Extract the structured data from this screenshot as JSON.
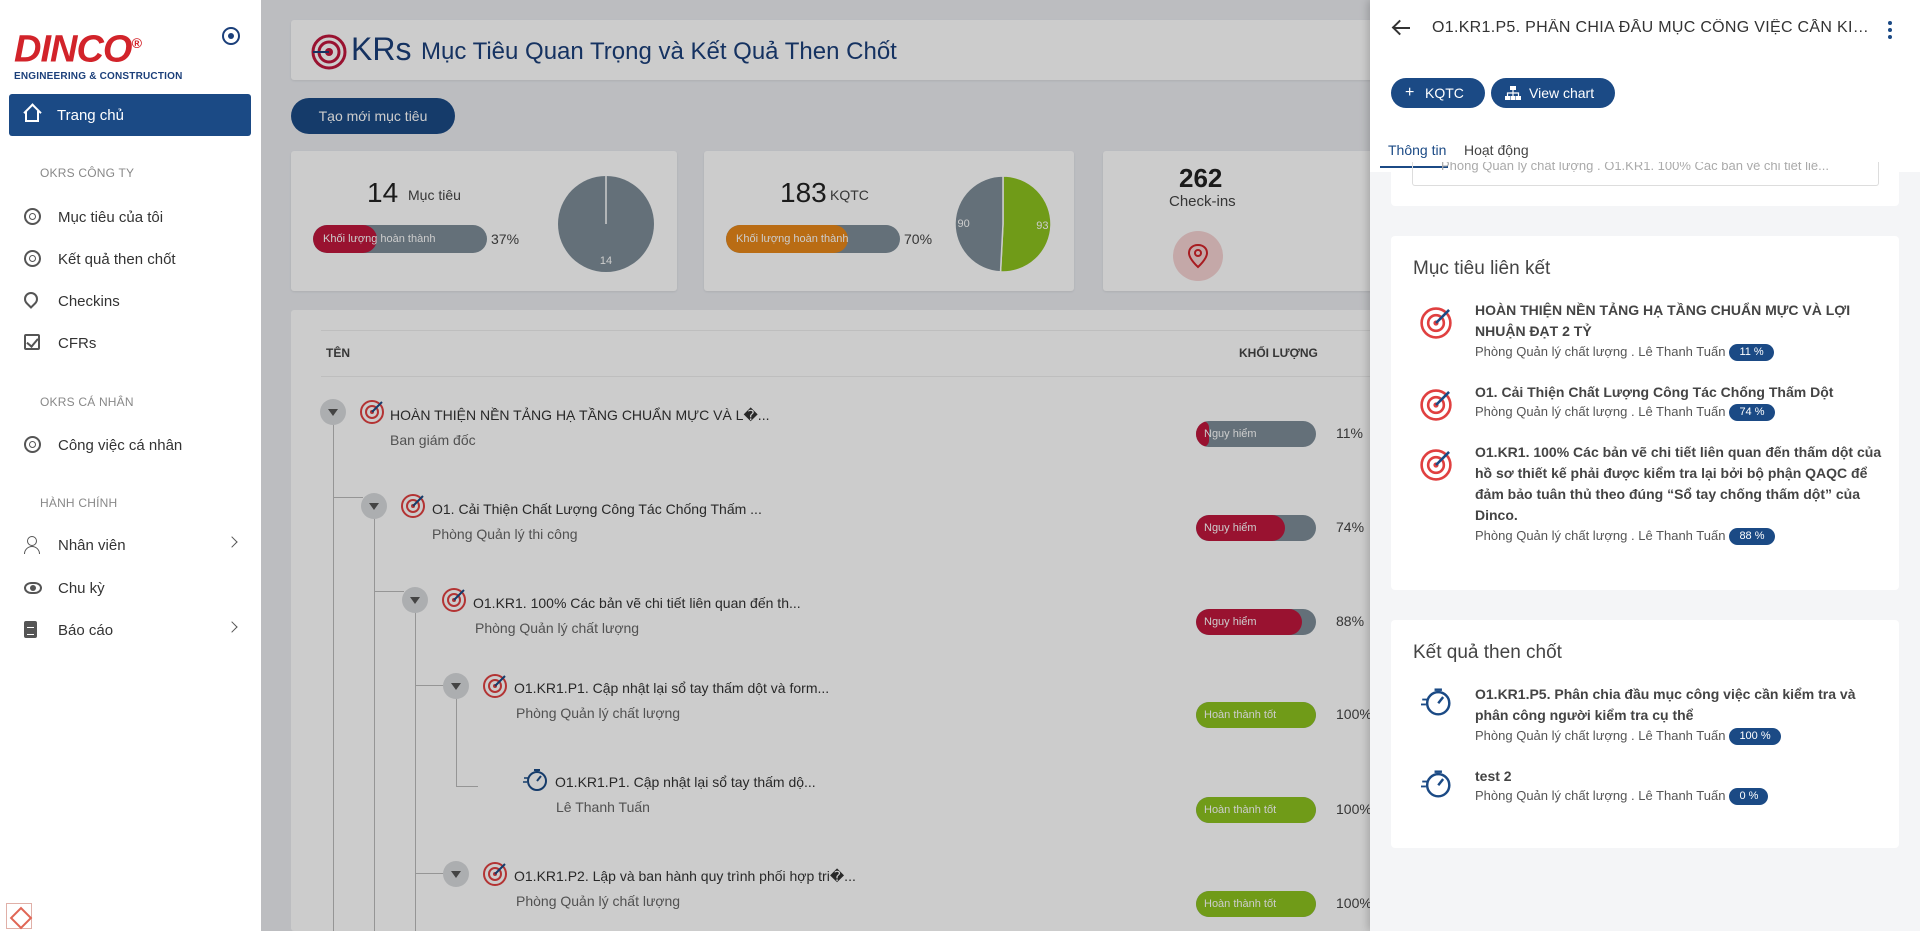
{
  "brand": {
    "logo_name": "DINCO",
    "logo_registered": "®",
    "logo_sub": "ENGINEERING & CONSTRUCTION"
  },
  "sidebar": {
    "home": "Trang chủ",
    "sections": [
      {
        "label": "OKRS CÔNG TY",
        "items": [
          "Mục tiêu của tôi",
          "Kết quả then chốt",
          "Checkins",
          "CFRs"
        ]
      },
      {
        "label": "OKRS CÁ NHÂN",
        "items": [
          "Công việc cá nhân"
        ]
      },
      {
        "label": "HÀNH CHÍNH",
        "items": [
          "Nhân viên",
          "Chu kỳ",
          "Báo cáo"
        ]
      }
    ]
  },
  "header": {
    "logo_text": "KRs",
    "title": "Mục Tiêu Quan Trọng và Kết Quả Then Chốt",
    "new_button": "Tạo mới mục tiêu"
  },
  "stats": [
    {
      "number": "14",
      "label": "Mục tiêu",
      "bar_label": "Khối lượng hoàn thành",
      "percent": "37%",
      "progress": 0.37,
      "bar_color": "#c0173c",
      "pie": {
        "slices": [
          {
            "value": 14,
            "label": "14",
            "color": "#7d8d98"
          }
        ]
      }
    },
    {
      "number": "183",
      "label": "KQTC",
      "bar_label": "Khối lượng hoàn thành",
      "percent": "70%",
      "progress": 0.7,
      "bar_color": "#e8881a",
      "pie": {
        "slices": [
          {
            "value": 93,
            "label": "93",
            "color": "#8dc21f"
          },
          {
            "value": 90,
            "label": "90",
            "color": "#7d8d98"
          }
        ]
      }
    },
    {
      "number": "262",
      "label": "Check-ins"
    }
  ],
  "table": {
    "col_name": "TÊN",
    "col_volume": "KHỐI LƯỢNG",
    "rows": [
      {
        "title": "HOÀN THIỆN NỀN TẢNG HẠ TẦNG CHUẨN MỰC VÀ L�...",
        "sub": "Ban giám đốc",
        "status": "Nguy hiểm",
        "pct": "11%",
        "progress": 0.11,
        "color": "#c0173c"
      },
      {
        "title": "O1. Cải Thiện Chất Lượng Công Tác Chống Thấm ...",
        "sub": "Phòng Quản lý thi công",
        "status": "Nguy hiểm",
        "pct": "74%",
        "progress": 0.74,
        "color": "#c0173c"
      },
      {
        "title": "O1.KR1. 100% Các bản vẽ chi tiết liên quan đến th...",
        "sub": "Phòng Quản lý chất lượng",
        "status": "Nguy hiểm",
        "pct": "88%",
        "progress": 0.88,
        "color": "#c0173c"
      },
      {
        "title": "O1.KR1.P1. Cập nhật lại sổ tay thấm dột và form...",
        "sub": "Phòng Quản lý chất lượng",
        "status": "Hoàn thành tốt",
        "pct": "100%",
        "progress": 1.0,
        "color": "#8dc21f"
      },
      {
        "title": "O1.KR1.P1. Cập nhật lại sổ tay thấm dộ...",
        "sub": "Lê Thanh Tuấn",
        "status": "Hoàn thành tốt",
        "pct": "100%",
        "progress": 1.0,
        "color": "#8dc21f"
      },
      {
        "title": "O1.KR1.P2. Lập và ban hành quy trình phối hợp tri�...",
        "sub": "Phòng Quản lý chất lượng",
        "status": "Hoàn thành tốt",
        "pct": "100%",
        "progress": 1.0,
        "color": "#8dc21f"
      }
    ]
  },
  "drawer": {
    "title": "O1.KR1.P5. PHÂN CHIA ĐẦU MỤC CÔNG VIỆC CẦN KIỂM ...",
    "btn_kqtc": "KQTC",
    "btn_chart": "View chart",
    "tab_info": "Thông tin",
    "tab_activity": "Hoạt động",
    "peek_text": "Phòng Quản lý chất lượng . O1.KR1. 100% Các bản vẽ chi tiết liê...",
    "linked_heading": "Mục tiêu liên kết",
    "linked": [
      {
        "title": "HOÀN THIỆN NỀN TẢNG HẠ TẦNG CHUẨN MỰC VÀ LỢI NHUẬN ĐẠT 2 TỶ",
        "meta": "Phòng Quản lý chất lượng . Lê Thanh Tuấn",
        "badge": "11 %"
      },
      {
        "title": "O1. Cải Thiện Chất Lượng Công Tác Chống Thấm Dột",
        "meta": "Phòng Quản lý chất lượng . Lê Thanh Tuấn",
        "badge": "74 %"
      },
      {
        "title": "O1.KR1. 100% Các bản vẽ chi tiết liên quan đến thấm dột của hồ sơ thiết kế phải được kiểm tra lại bởi bộ phận QAQC để đảm bảo tuân thủ theo đúng “Sổ tay chống thấm dột” của Dinco.",
        "meta": "Phòng Quản lý chất lượng . Lê Thanh Tuấn",
        "badge": "88 %"
      }
    ],
    "kr_heading": "Kết quả then chốt",
    "krs": [
      {
        "title": "O1.KR1.P5. Phân chia đầu mục công việc cần kiểm tra và phân công người kiểm tra cụ thể",
        "meta": "Phòng Quản lý chất lượng . Lê Thanh Tuấn",
        "badge": "100 %"
      },
      {
        "title": "test 2",
        "meta": "Phòng Quản lý chất lượng . Lê Thanh Tuấn",
        "badge": "0 %"
      }
    ]
  },
  "colors": {
    "primary": "#1b4a85",
    "danger": "#c0173c",
    "good": "#8dc21f",
    "warning": "#e8881a",
    "neutral": "#7d8d98"
  }
}
